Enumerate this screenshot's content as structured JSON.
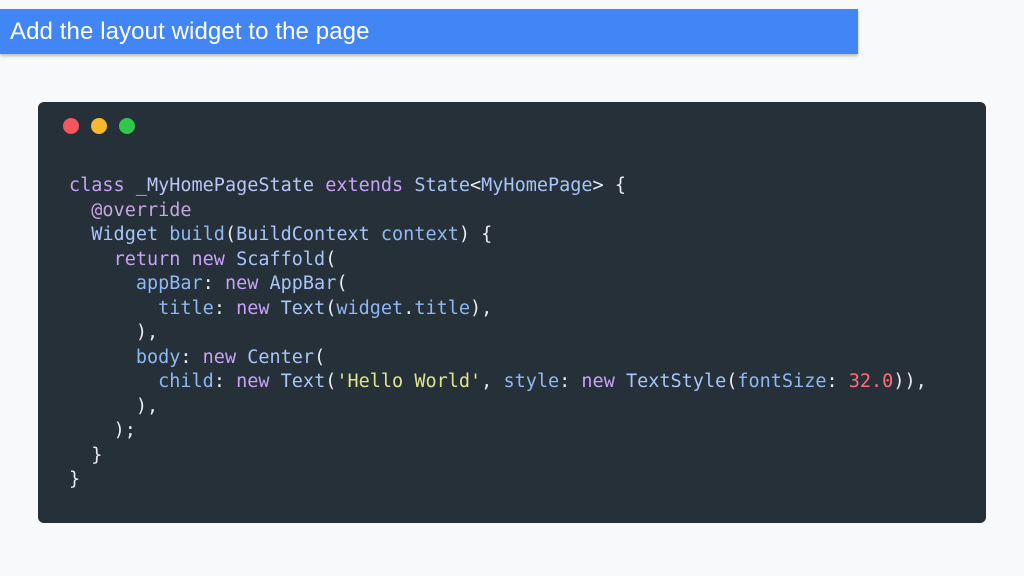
{
  "slide": {
    "title": "Add the layout widget to the page"
  },
  "window": {
    "dots": [
      {
        "name": "close",
        "color": "#f3565d"
      },
      {
        "name": "minimize",
        "color": "#f8b82e"
      },
      {
        "name": "maximize",
        "color": "#2fc84a"
      }
    ]
  },
  "colors": {
    "banner": "#4285f4",
    "code_background": "#263039",
    "page_background": "#f8f9fa"
  },
  "code": {
    "language": "dart",
    "lines": [
      [
        {
          "t": "class",
          "k": "keyword"
        },
        {
          "t": " ",
          "k": "plain"
        },
        {
          "t": "_MyHomePageState",
          "k": "class"
        },
        {
          "t": " ",
          "k": "plain"
        },
        {
          "t": "extends",
          "k": "keyword"
        },
        {
          "t": " ",
          "k": "plain"
        },
        {
          "t": "State",
          "k": "type"
        },
        {
          "t": "<",
          "k": "punct"
        },
        {
          "t": "MyHomePage",
          "k": "type"
        },
        {
          "t": "> {",
          "k": "punct"
        }
      ],
      [
        {
          "t": "  ",
          "k": "plain"
        },
        {
          "t": "@override",
          "k": "annot"
        }
      ],
      [
        {
          "t": "  ",
          "k": "plain"
        },
        {
          "t": "Widget",
          "k": "type"
        },
        {
          "t": " ",
          "k": "plain"
        },
        {
          "t": "build",
          "k": "prop"
        },
        {
          "t": "(",
          "k": "punct"
        },
        {
          "t": "BuildContext",
          "k": "type"
        },
        {
          "t": " ",
          "k": "plain"
        },
        {
          "t": "context",
          "k": "prop"
        },
        {
          "t": ") {",
          "k": "punct"
        }
      ],
      [
        {
          "t": "    ",
          "k": "plain"
        },
        {
          "t": "return",
          "k": "keyword"
        },
        {
          "t": " ",
          "k": "plain"
        },
        {
          "t": "new",
          "k": "keyword"
        },
        {
          "t": " ",
          "k": "plain"
        },
        {
          "t": "Scaffold",
          "k": "type"
        },
        {
          "t": "(",
          "k": "punct"
        }
      ],
      [
        {
          "t": "      ",
          "k": "plain"
        },
        {
          "t": "appBar",
          "k": "prop"
        },
        {
          "t": ": ",
          "k": "punct"
        },
        {
          "t": "new",
          "k": "keyword"
        },
        {
          "t": " ",
          "k": "plain"
        },
        {
          "t": "AppBar",
          "k": "type"
        },
        {
          "t": "(",
          "k": "punct"
        }
      ],
      [
        {
          "t": "        ",
          "k": "plain"
        },
        {
          "t": "title",
          "k": "prop"
        },
        {
          "t": ": ",
          "k": "punct"
        },
        {
          "t": "new",
          "k": "keyword"
        },
        {
          "t": " ",
          "k": "plain"
        },
        {
          "t": "Text",
          "k": "type"
        },
        {
          "t": "(",
          "k": "punct"
        },
        {
          "t": "widget",
          "k": "prop"
        },
        {
          "t": ".",
          "k": "punct"
        },
        {
          "t": "title",
          "k": "prop"
        },
        {
          "t": "),",
          "k": "punct"
        }
      ],
      [
        {
          "t": "      ",
          "k": "plain"
        },
        {
          "t": "),",
          "k": "punct"
        }
      ],
      [
        {
          "t": "      ",
          "k": "plain"
        },
        {
          "t": "body",
          "k": "prop"
        },
        {
          "t": ": ",
          "k": "punct"
        },
        {
          "t": "new",
          "k": "keyword"
        },
        {
          "t": " ",
          "k": "plain"
        },
        {
          "t": "Center",
          "k": "type"
        },
        {
          "t": "(",
          "k": "punct"
        }
      ],
      [
        {
          "t": "        ",
          "k": "plain"
        },
        {
          "t": "child",
          "k": "prop"
        },
        {
          "t": ": ",
          "k": "punct"
        },
        {
          "t": "new",
          "k": "keyword"
        },
        {
          "t": " ",
          "k": "plain"
        },
        {
          "t": "Text",
          "k": "type"
        },
        {
          "t": "(",
          "k": "punct"
        },
        {
          "t": "'Hello World'",
          "k": "string"
        },
        {
          "t": ", ",
          "k": "punct"
        },
        {
          "t": "style",
          "k": "prop"
        },
        {
          "t": ": ",
          "k": "punct"
        },
        {
          "t": "new",
          "k": "keyword"
        },
        {
          "t": " ",
          "k": "plain"
        },
        {
          "t": "TextStyle",
          "k": "type"
        },
        {
          "t": "(",
          "k": "punct"
        },
        {
          "t": "fontSize",
          "k": "prop"
        },
        {
          "t": ": ",
          "k": "punct"
        },
        {
          "t": "32.0",
          "k": "number"
        },
        {
          "t": ")),",
          "k": "punct"
        }
      ],
      [
        {
          "t": "      ",
          "k": "plain"
        },
        {
          "t": "),",
          "k": "punct"
        }
      ],
      [
        {
          "t": "    ",
          "k": "plain"
        },
        {
          "t": ");",
          "k": "punct"
        }
      ],
      [
        {
          "t": "  ",
          "k": "plain"
        },
        {
          "t": "}",
          "k": "punct"
        }
      ],
      [
        {
          "t": "}",
          "k": "punct"
        }
      ]
    ]
  }
}
